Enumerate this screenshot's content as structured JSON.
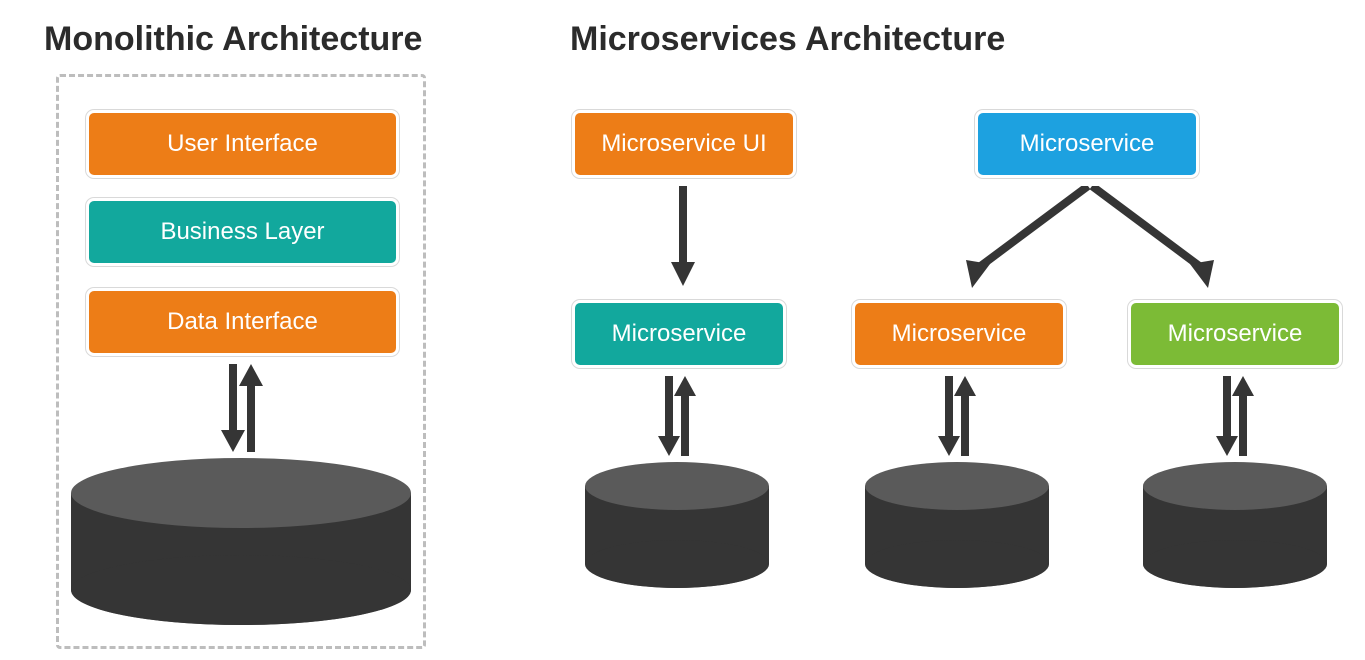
{
  "monolithic": {
    "title": "Monolithic Architecture",
    "layers": [
      {
        "label": "User Interface",
        "color": "orange"
      },
      {
        "label": "Business Layer",
        "color": "teal"
      },
      {
        "label": "Data Interface",
        "color": "orange"
      }
    ]
  },
  "microservices": {
    "title": "Microservices Architecture",
    "top_boxes": [
      {
        "label": "Microservice UI",
        "color": "orange"
      },
      {
        "label": "Microservice",
        "color": "blue"
      }
    ],
    "bottom_boxes": [
      {
        "label": "Microservice",
        "color": "teal"
      },
      {
        "label": "Microservice",
        "color": "orange"
      },
      {
        "label": "Microservice",
        "color": "green"
      }
    ]
  }
}
